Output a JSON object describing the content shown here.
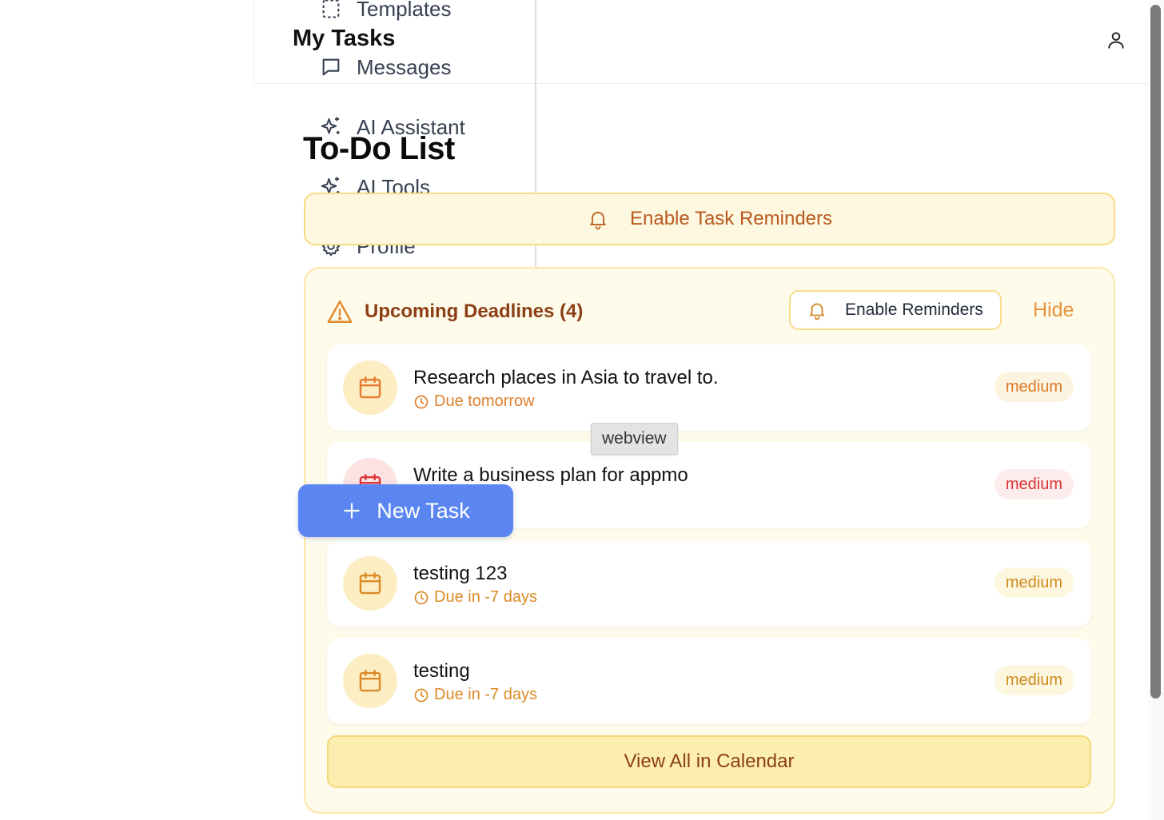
{
  "header": {
    "title": "My Tasks",
    "user_icon": "user-icon"
  },
  "sidebar": {
    "items": [
      {
        "label": "Templates",
        "icon": "template-icon"
      },
      {
        "label": "Messages",
        "icon": "message-icon"
      },
      {
        "label": "AI Assistant",
        "icon": "sparkle-icon"
      },
      {
        "label": "AI Tools",
        "icon": "sparkle-icon"
      },
      {
        "label": "Profile",
        "icon": "gear-icon"
      }
    ]
  },
  "main": {
    "title": "To-Do List",
    "reminder_banner": {
      "label": "Enable Task Reminders",
      "icon": "bell-icon"
    },
    "deadlines": {
      "heading": "Upcoming Deadlines (4)",
      "enable_reminders_label": "Enable Reminders",
      "hide_label": "Hide",
      "tasks": [
        {
          "title": "Research places in Asia to travel to.",
          "due": "Due tomorrow",
          "priority": "medium"
        },
        {
          "title": "Write a business plan for appmo",
          "due": "",
          "priority": "medium"
        },
        {
          "title": "testing 123",
          "due": "Due in -7 days",
          "priority": "medium"
        },
        {
          "title": "testing",
          "due": "Due in -7 days",
          "priority": "medium"
        }
      ],
      "view_all_label": "View All in Calendar"
    },
    "new_task_label": "New Task"
  },
  "tooltip": {
    "text": "webview"
  },
  "colors": {
    "accent_blue": "#5b86f2",
    "amber_text": "#8c3f14",
    "orange": "#df7f2c",
    "red": "#dc3535"
  }
}
